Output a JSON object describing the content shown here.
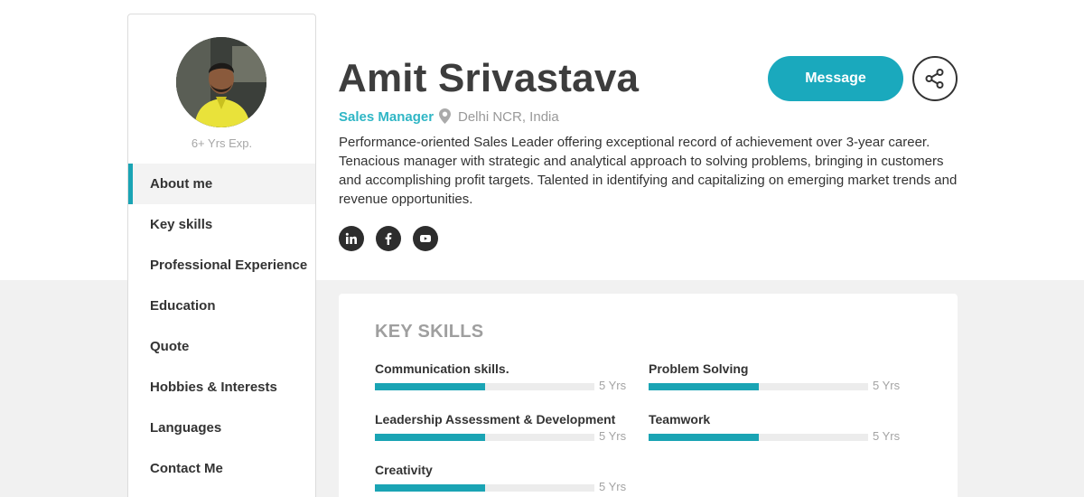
{
  "profile": {
    "name": "Amit Srivastava",
    "role": "Sales Manager",
    "location": "Delhi NCR, India",
    "experience": "6+ Yrs Exp.",
    "bio": "Performance-oriented Sales Leader offering exceptional record of achievement over 3-year career. Tenacious manager with strategic and analytical approach to solving problems, bringing in customers and accomplishing profit targets. Talented in identifying and capitalizing on emerging market trends and revenue opportunities."
  },
  "actions": {
    "message_label": "Message",
    "share_icon": "share-icon"
  },
  "social": [
    {
      "icon": "linkedin-icon"
    },
    {
      "icon": "facebook-icon"
    },
    {
      "icon": "youtube-icon"
    }
  ],
  "nav": {
    "active_index": 0,
    "items": [
      {
        "label": "About me"
      },
      {
        "label": "Key skills"
      },
      {
        "label": "Professional Experience"
      },
      {
        "label": "Education"
      },
      {
        "label": "Quote"
      },
      {
        "label": "Hobbies & Interests"
      },
      {
        "label": "Languages"
      },
      {
        "label": "Contact Me"
      }
    ]
  },
  "skills": {
    "title": "KEY SKILLS",
    "items": [
      {
        "name": "Communication skills.",
        "years": "5 Yrs",
        "level": 0.5
      },
      {
        "name": "Problem Solving",
        "years": "5 Yrs",
        "level": 0.5
      },
      {
        "name": "Leadership Assessment & Development",
        "years": "5 Yrs",
        "level": 0.5
      },
      {
        "name": "Teamwork",
        "years": "5 Yrs",
        "level": 0.5
      },
      {
        "name": "Creativity",
        "years": "5 Yrs",
        "level": 0.5
      }
    ]
  },
  "colors": {
    "accent": "#1aa4b4",
    "role_text": "#2fb6c5",
    "button": "#1aa9bd",
    "background": "#f1f1f1"
  }
}
